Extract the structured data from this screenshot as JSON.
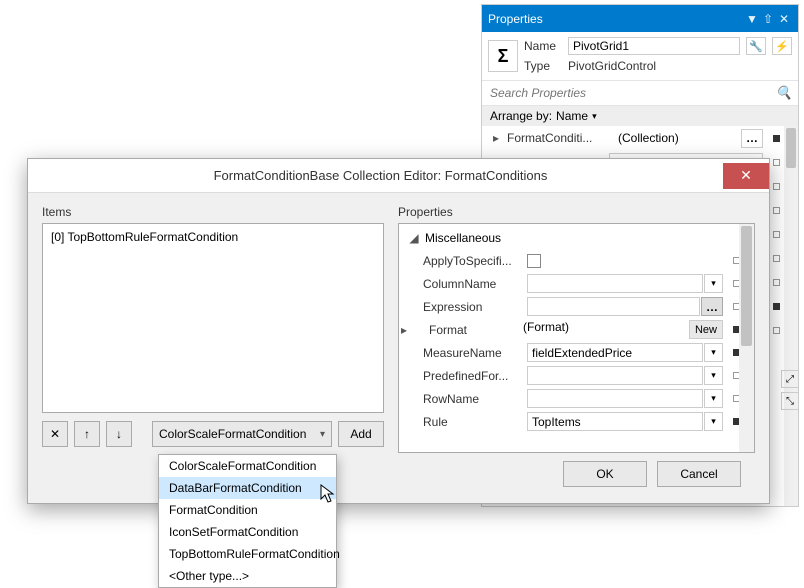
{
  "props_panel": {
    "title": "Properties",
    "name_label": "Name",
    "name_value": "PivotGrid1",
    "type_label": "Type",
    "type_value": "PivotGridControl",
    "search_placeholder": "Search Properties",
    "arrange_label": "Arrange by:",
    "arrange_value": "Name",
    "first_row_name": "FormatConditi...",
    "first_row_value": "(Collection)"
  },
  "dialog": {
    "title": "FormatConditionBase Collection Editor: FormatConditions",
    "items_label": "Items",
    "properties_label": "Properties",
    "items": [
      "[0] TopBottomRuleFormatCondition"
    ],
    "type_selected": "ColorScaleFormatCondition",
    "add_label": "Add",
    "type_options": [
      "ColorScaleFormatCondition",
      "DataBarFormatCondition",
      "FormatCondition",
      "IconSetFormatCondition",
      "TopBottomRuleFormatCondition",
      "<Other type...>"
    ],
    "type_highlighted": "DataBarFormatCondition",
    "ok_label": "OK",
    "cancel_label": "Cancel",
    "category": "Miscellaneous",
    "props": {
      "apply": {
        "label": "ApplyToSpecifi...",
        "checked": false
      },
      "column": {
        "label": "ColumnName",
        "value": ""
      },
      "expression": {
        "label": "Expression",
        "value": ""
      },
      "format": {
        "label": "Format",
        "value": "(Format)",
        "new_label": "New"
      },
      "measure": {
        "label": "MeasureName",
        "value": "fieldExtendedPrice"
      },
      "predefined": {
        "label": "PredefinedFor...",
        "value": ""
      },
      "rowname": {
        "label": "RowName",
        "value": ""
      },
      "rule": {
        "label": "Rule",
        "value": "TopItems"
      }
    }
  }
}
